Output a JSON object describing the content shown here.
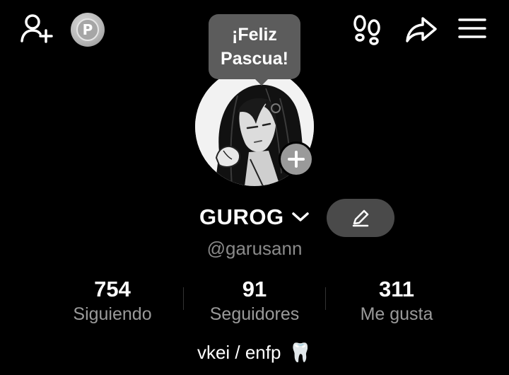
{
  "header": {
    "icons": [
      "add-user-icon",
      "coin-icon",
      "footprints-icon",
      "share-icon",
      "menu-icon"
    ],
    "coin_letter": "P"
  },
  "profile": {
    "bubble_text": "¡Feliz\nPascua!",
    "display_name": "GUROG",
    "handle": "@garusann",
    "bio_text": "vkei / enfp",
    "bio_emoji": "🦷"
  },
  "stats": [
    {
      "value": "754",
      "label": "Siguiendo"
    },
    {
      "value": "91",
      "label": "Seguidores"
    },
    {
      "value": "311",
      "label": "Me gusta"
    }
  ]
}
